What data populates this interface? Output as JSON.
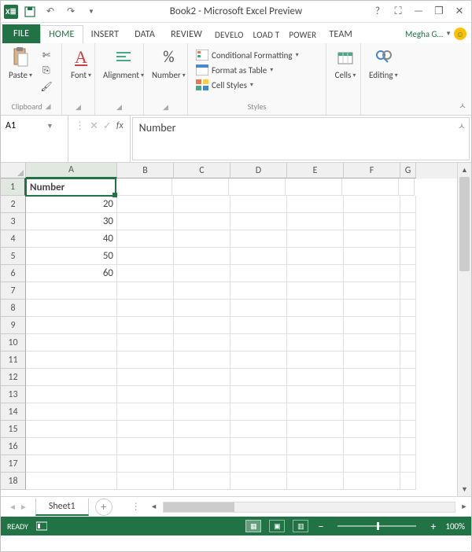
{
  "titlebar": {
    "title": "Book2 - Microsoft Excel Preview"
  },
  "tabs": {
    "file": "FILE",
    "items": [
      "HOME",
      "INSERT",
      "DATA",
      "REVIEW",
      "DEVELO",
      "LOAD T",
      "POWER",
      "TEAM"
    ],
    "active": "HOME",
    "user": "Megha G…"
  },
  "ribbon": {
    "clipboard": {
      "paste": "Paste",
      "label": "Clipboard"
    },
    "font": {
      "btn": "Font",
      "label": ""
    },
    "alignment": {
      "btn": "Alignment",
      "label": ""
    },
    "number": {
      "btn": "Number",
      "label": ""
    },
    "styles": {
      "cond": "Conditional Formatting",
      "table": "Format as Table",
      "cell": "Cell Styles",
      "label": "Styles"
    },
    "cells": {
      "btn": "Cells",
      "label": ""
    },
    "editing": {
      "btn": "Editing",
      "label": ""
    }
  },
  "formula": {
    "namebox": "A1",
    "value": "Number"
  },
  "columns": [
    "A",
    "B",
    "C",
    "D",
    "E",
    "F",
    "G"
  ],
  "rows_count": 18,
  "active_cell": "A1",
  "data": {
    "A1": "Number",
    "A2": "20",
    "A3": "30",
    "A4": "40",
    "A5": "50",
    "A6": "60"
  },
  "sheets": {
    "active": "Sheet1"
  },
  "status": {
    "ready": "READY",
    "zoom": "100%"
  },
  "chart_data": {
    "type": "table",
    "columns": [
      "Number"
    ],
    "values": [
      20,
      30,
      40,
      50,
      60
    ]
  }
}
